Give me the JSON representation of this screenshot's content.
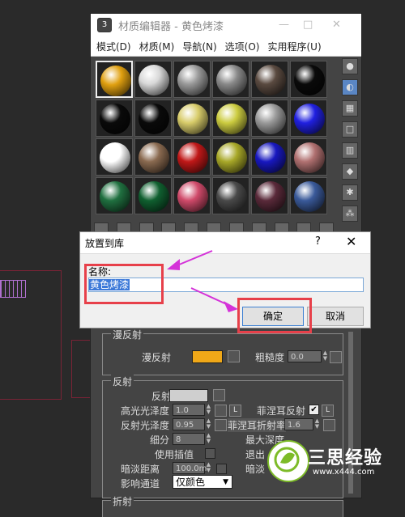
{
  "material_editor": {
    "title": "材质编辑器 - 黄色烤漆",
    "logo_text": "3",
    "menu": [
      "模式(D)",
      "材质(M)",
      "导航(N)",
      "选项(O)",
      "实用程序(U)"
    ],
    "window_buttons": [
      "—",
      "□",
      "✕"
    ],
    "slot_colors": [
      "#e0a010",
      "#d8d8d8",
      "#9a9a9a",
      "#8a8a8a",
      "#5a4a40",
      "#0a0a0a",
      "#0a0a0a",
      "#0a0a0a",
      "#d8cc6a",
      "#cccc40",
      "#9a9a9a",
      "#2020e0",
      "#ffffff",
      "#8a6a50",
      "#c01818",
      "#a8a828",
      "#1818c0",
      "#b07070",
      "#207040",
      "#106030",
      "#d04a6a",
      "#4a4a4a",
      "#5a2a3a",
      "#3a5a9a"
    ]
  },
  "dialog": {
    "title": "放置到库",
    "help": "?",
    "close": "✕",
    "name_label": "名称:",
    "name_value": "黄色烤漆",
    "ok_label": "确定",
    "cancel_label": "取消"
  },
  "diffuse_group": {
    "title": "漫反射",
    "diffuse_label": "漫反射",
    "diffuse_color": "#f0a818",
    "roughness_label": "粗糙度",
    "roughness_value": "0.0"
  },
  "reflection_group": {
    "title": "反射",
    "reflect_label": "反射",
    "reflect_color": "#cfcfcf",
    "hilight_gloss_label": "高光光泽度",
    "hilight_gloss_value": "1.0",
    "lock_label": "L",
    "fresnel_label": "菲涅耳反射",
    "fresnel_checked": "✔",
    "fresnel_lock": "L",
    "refl_gloss_label": "反射光泽度",
    "refl_gloss_value": "0.95",
    "fresnel_ior_label": "菲涅耳折射率",
    "fresnel_ior_value": "1.6",
    "subdivs_label": "细分",
    "subdivs_value": "8",
    "max_depth_label": "最大深度",
    "use_interp_label": "使用插值",
    "exit_label": "退出",
    "dim_dist_label": "暗淡距离",
    "dim_dist_value": "100.0m",
    "dim_label": "暗淡",
    "affect_channels_label": "影响通道",
    "affect_channels_value": "仅颜色"
  },
  "refraction_group": {
    "title": "折射"
  },
  "watermark": {
    "text": "三思经验",
    "url": "www.x444.com"
  }
}
